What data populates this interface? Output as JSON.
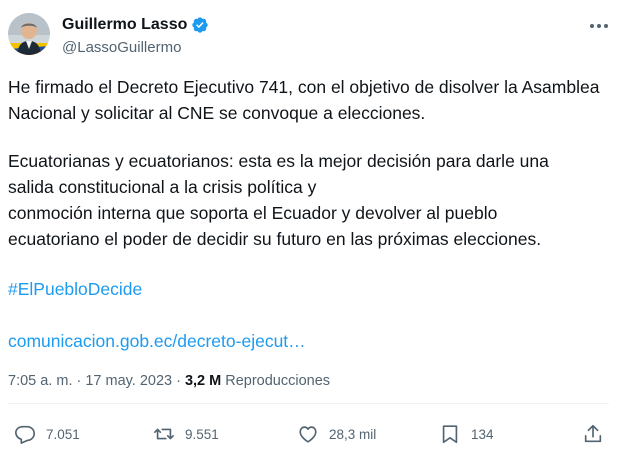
{
  "author": {
    "name": "Guillermo Lasso",
    "handle": "@LassoGuillermo",
    "verified": true
  },
  "tweet": {
    "paragraph1": "He firmado el Decreto Ejecutivo 741, con el objetivo de disolver la Asamblea Nacional y solicitar al CNE se convoque a elecciones.",
    "paragraph2_line1": "Ecuatorianas y ecuatorianos: esta es la mejor decisión para darle una",
    "paragraph2_line2": "salida constitucional a la crisis política y",
    "paragraph2_line3": "conmoción interna que soporta el Ecuador y devolver al pueblo",
    "paragraph2_line4": "ecuatoriano el poder de decidir su futuro en las próximas elecciones.",
    "hashtag": "#ElPuebloDecide",
    "link": "comunicacion.gob.ec/decreto-ejecut…"
  },
  "meta": {
    "time": "7:05 a. m.",
    "separator": "·",
    "date": "17 may. 2023",
    "views_count": "3,2 M",
    "views_label": "Reproducciones"
  },
  "actions": {
    "replies": "7.051",
    "retweets": "9.551",
    "likes": "28,3 mil",
    "bookmarks": "134"
  },
  "colors": {
    "text": "#0f1419",
    "secondary": "#536471",
    "link": "#1d9bf0",
    "verified_badge": "#1d9bf0"
  },
  "icons": [
    "verified-badge-icon",
    "more-icon",
    "reply-icon",
    "retweet-icon",
    "like-icon",
    "bookmark-icon",
    "share-icon"
  ]
}
